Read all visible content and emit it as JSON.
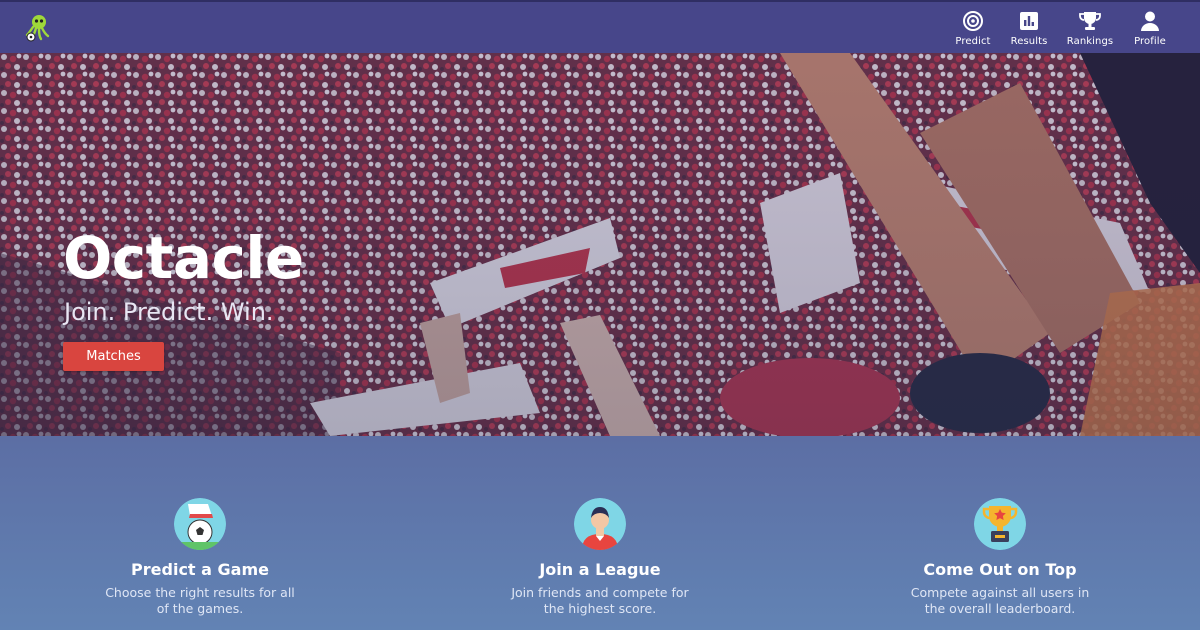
{
  "nav": {
    "items": [
      {
        "label": "Predict",
        "icon": "target-icon"
      },
      {
        "label": "Results",
        "icon": "bar-chart-icon"
      },
      {
        "label": "Rankings",
        "icon": "trophy-icon"
      },
      {
        "label": "Profile",
        "icon": "user-icon"
      }
    ]
  },
  "hero": {
    "title": "Octacle",
    "subtitle": "Join. Predict. Win.",
    "button_label": "Matches"
  },
  "features": [
    {
      "title": "Predict a Game",
      "description": "Choose the right results for all of the games.",
      "icon": "soccer-ball-icon"
    },
    {
      "title": "Join a League",
      "description": "Join friends and compete for the highest score.",
      "icon": "player-icon"
    },
    {
      "title": "Come Out on Top",
      "description": "Compete against all users in the overall leaderboard.",
      "icon": "trophy-award-icon"
    }
  ],
  "colors": {
    "navbar": "#47468a",
    "button": "#d9453f",
    "features_bg": "#5c6ea4"
  }
}
